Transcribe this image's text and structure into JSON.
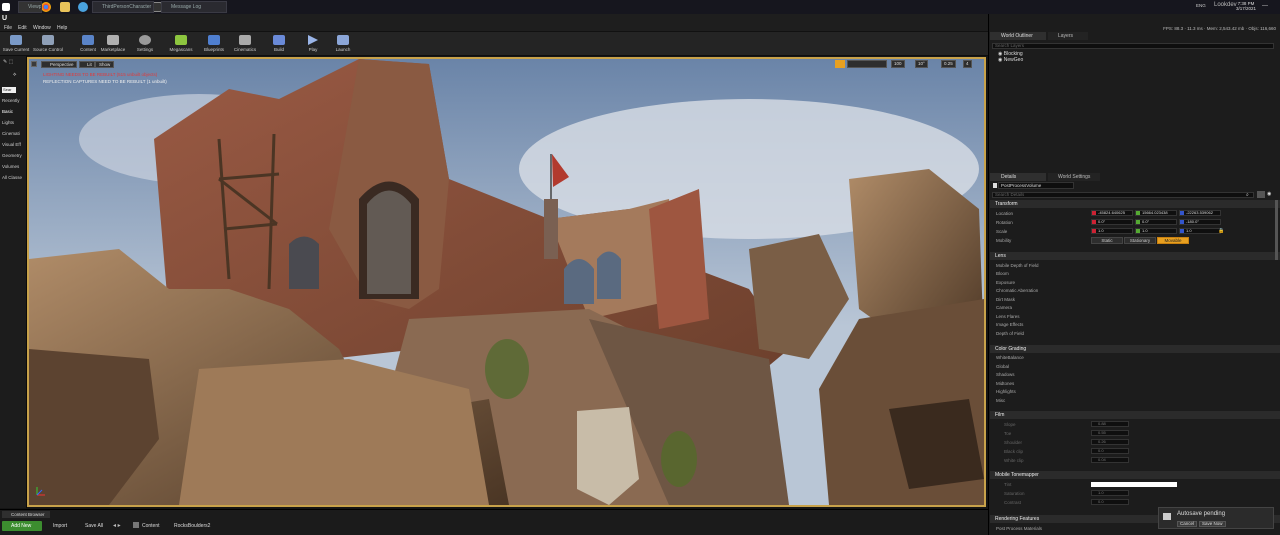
{
  "taskbar": {
    "tabs": [
      "Viewport",
      "ThirdPersonCharacter",
      "Message Log"
    ],
    "app_title": "Lookdev",
    "clock_time": "7:38 PM",
    "clock_date": "3/17/2021",
    "lang": "ENG"
  },
  "menu": [
    "File",
    "Edit",
    "Window",
    "Help"
  ],
  "toolbar": [
    "Save Current",
    "Source Control",
    "Content",
    "Marketplace",
    "Settings",
    "Megascans",
    "Blueprints",
    "Cinematics",
    "Build",
    "Play",
    "Launch"
  ],
  "stats": {
    "fps": "FPS: 88.3",
    "ms": "11.3 ms",
    "mem": "Mem: 2,543.42 mb",
    "objs": "Objs: 116,660"
  },
  "modes": {
    "search": "Sear",
    "items": [
      "Recently",
      "Basic",
      "Lights",
      "Cinemati",
      "Visual Eff",
      "Geometry",
      "Volumes",
      "All Classe"
    ]
  },
  "viewport": {
    "buttons": [
      "Perspective",
      "Lit",
      "Show"
    ],
    "warning_lighting": "LIGHTING NEEDS TO BE REBUILT (515 unbuilt objects)",
    "warning_reflection": "REFLECTION CAPTURES NEED TO BE REBUILT (1 unbuilt)",
    "controls": [
      "100",
      "10°",
      "0.25",
      "4"
    ]
  },
  "outliner": {
    "tab": "World Outliner",
    "tab2": "Layers",
    "search_placeholder": "Search Layers",
    "items": [
      "Blocking",
      "NewGeo"
    ]
  },
  "details": {
    "tab": "Details",
    "tab2": "World Settings",
    "object_name": "PostProcessVolume",
    "search_placeholder": "Search Details",
    "transform": {
      "title": "Transform",
      "location_label": "Location",
      "location": [
        "-45824.640625",
        "15664.023438",
        "-22263.539062"
      ],
      "rotation_label": "Rotation",
      "rotation": [
        "0.0°",
        "0.0°",
        "-180.0°"
      ],
      "scale_label": "Scale",
      "scale": [
        "1.0",
        "1.0",
        "1.0"
      ],
      "mobility_label": "Mobility",
      "mobility": [
        "Static",
        "Stationary",
        "Movable"
      ]
    },
    "lens": {
      "title": "Lens",
      "items": [
        "Mobile Depth of Field",
        "Bloom",
        "Exposure",
        "Chromatic Aberration",
        "Dirt Mask",
        "Camera",
        "Lens Flares",
        "Image Effects",
        "Depth of Field"
      ]
    },
    "color_grading": {
      "title": "Color Grading",
      "items": [
        "WhiteBalance",
        "Global",
        "Shadows",
        "Midtones",
        "Highlights",
        "Misc"
      ]
    },
    "film": {
      "title": "Film",
      "items": [
        "Slope",
        "Toe",
        "Shoulder",
        "Black clip",
        "White clip"
      ],
      "values": [
        "0.88",
        "0.55",
        "0.26",
        "0.0",
        "0.04"
      ]
    },
    "tonemapper": {
      "title": "Mobile Tonemapper",
      "items": [
        "Tint",
        "Saturation",
        "Contrast"
      ],
      "values": [
        "1.0",
        "0.0"
      ]
    },
    "rendering": {
      "title": "Rendering Features",
      "items": [
        "Post Process Materials"
      ]
    }
  },
  "content_browser": {
    "tab": "Content Browser",
    "add_new": "Add New",
    "import": "Import",
    "save_all": "Save All",
    "path": [
      "Content",
      "RocksBoulders2"
    ]
  },
  "autosave": {
    "title": "Autosave pending",
    "cancel": "Cancel",
    "save_now": "Save Now"
  }
}
